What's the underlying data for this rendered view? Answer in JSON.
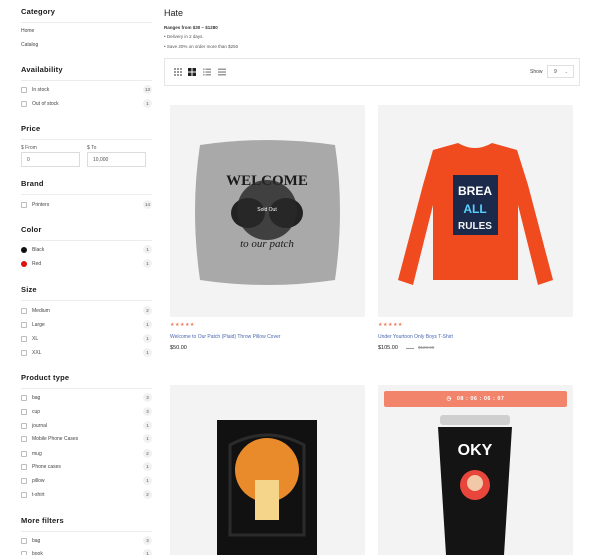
{
  "sidebar": {
    "category": {
      "title": "Category",
      "links": [
        "Home",
        "Catalog"
      ]
    },
    "availability": {
      "title": "Availability",
      "items": [
        {
          "label": "In stock",
          "count": "13"
        },
        {
          "label": "Out of stock",
          "count": "1"
        }
      ]
    },
    "price": {
      "title": "Price",
      "from_label": "$ From",
      "to_label": "$ To",
      "from_value": "0",
      "to_value": "10,000"
    },
    "brand": {
      "title": "Brand",
      "items": [
        {
          "label": "Printers",
          "count": "14"
        }
      ]
    },
    "color": {
      "title": "Color",
      "items": [
        {
          "label": "Black",
          "count": "1",
          "swatch": "#111111"
        },
        {
          "label": "Red",
          "count": "1",
          "swatch": "#e01010"
        }
      ]
    },
    "size": {
      "title": "Size",
      "items": [
        {
          "label": "Medium",
          "count": "2"
        },
        {
          "label": "Large",
          "count": "1"
        },
        {
          "label": "XL",
          "count": "1"
        },
        {
          "label": "XXL",
          "count": "1"
        }
      ]
    },
    "product_type": {
      "title": "Product type",
      "items": [
        {
          "label": "bag",
          "count": "3"
        },
        {
          "label": "cup",
          "count": "3"
        },
        {
          "label": "journal",
          "count": "1"
        },
        {
          "label": "Mobile Phone Cases",
          "count": "1"
        },
        {
          "label": "mug",
          "count": "2"
        },
        {
          "label": "Phone cases",
          "count": "1"
        },
        {
          "label": "pillow",
          "count": "1"
        },
        {
          "label": "t-shirt",
          "count": "2"
        }
      ]
    },
    "more_filters": {
      "title": "More filters",
      "items": [
        {
          "label": "bag",
          "count": "3"
        },
        {
          "label": "book",
          "count": "1"
        }
      ]
    }
  },
  "main": {
    "title": "Hate",
    "subtitle": "Ranges from $30 – $1280",
    "bullets": [
      "Delivery in 2 days.",
      "Save 20% on order more than $250"
    ],
    "toolbar": {
      "show_label": "Show",
      "show_value": "9",
      "views": [
        "grid-3-icon",
        "grid-2-icon",
        "list-icon",
        "list-compact-icon"
      ]
    },
    "products": [
      {
        "name": "Welcome to Our Patch (Plaid) Throw Pillow Cover",
        "price": "$50.00",
        "old_price": "",
        "rating": "★★★★★",
        "badge": "Sold Out"
      },
      {
        "name": "Under Yourtoon Only Boys T-Shirt",
        "price": "$105.00",
        "old_price": "$120.00",
        "rating": "★★★★★",
        "badge": ""
      },
      {
        "name": "",
        "price": "",
        "old_price": "",
        "rating": "",
        "badge": ""
      },
      {
        "name": "",
        "price": "",
        "old_price": "",
        "rating": "",
        "badge": "",
        "timer": "08 : 06 : 06 : 07"
      }
    ],
    "pillow_text": [
      "WELCOME",
      "to our patch"
    ],
    "shirt_text": [
      "BREA",
      "ALL",
      "RULES"
    ],
    "mug_text": "OKY"
  },
  "colors": {
    "accent": "#f2846b",
    "star": "#ef7a5b",
    "link": "#4a67b2"
  }
}
